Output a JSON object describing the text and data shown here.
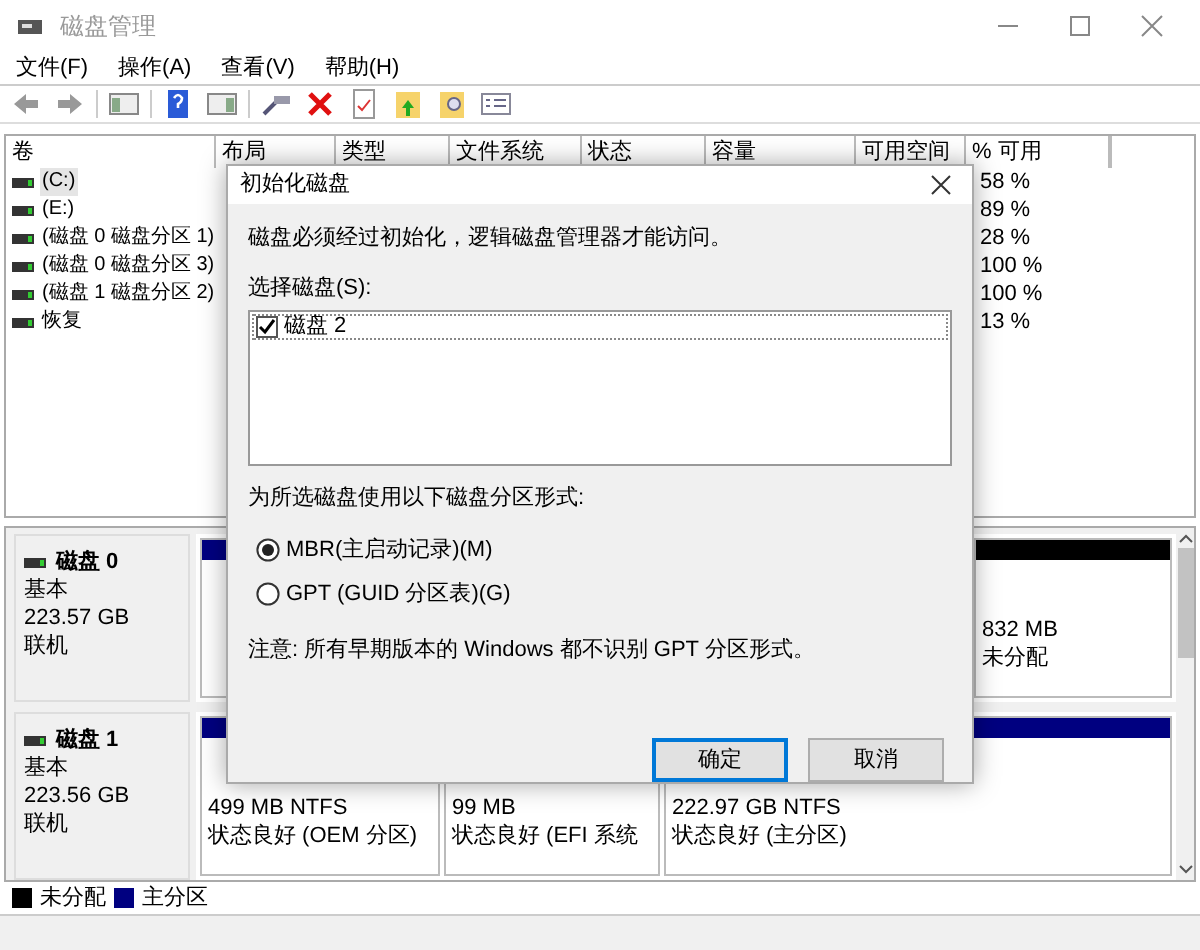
{
  "window": {
    "title": "磁盘管理"
  },
  "menu": [
    "文件(F)",
    "操作(A)",
    "查看(V)",
    "帮助(H)"
  ],
  "volume_table": {
    "columns": [
      "卷",
      "布局",
      "类型",
      "文件系统",
      "状态",
      "容量",
      "可用空间",
      "% 可用"
    ],
    "rows": [
      {
        "volume": "(C:)",
        "percent_free": "58 %",
        "selected": true
      },
      {
        "volume": "(E:)",
        "percent_free": "89 %",
        "selected": false
      },
      {
        "volume": "(磁盘 0 磁盘分区 1)",
        "percent_free": "28 %",
        "selected": false
      },
      {
        "volume": "(磁盘 0 磁盘分区 3)",
        "percent_free": "100 %",
        "selected": false
      },
      {
        "volume": "(磁盘 1 磁盘分区 2)",
        "percent_free": "100 %",
        "selected": false
      },
      {
        "volume": "恢复",
        "percent_free": "13 %",
        "selected": false
      }
    ]
  },
  "disks": [
    {
      "name": "磁盘 0",
      "type": "基本",
      "size": "223.57 GB",
      "status": "联机",
      "partitions": [
        {
          "kind": "primary"
        },
        {
          "kind": "unallocated",
          "lines": [
            "832 MB",
            "未分配"
          ]
        }
      ]
    },
    {
      "name": "磁盘 1",
      "type": "基本",
      "size": "223.56 GB",
      "status": "联机",
      "partitions": [
        {
          "kind": "primary",
          "lines": [
            "499 MB NTFS",
            "状态良好 (OEM 分区)"
          ]
        },
        {
          "lines": [
            "99 MB",
            "状态良好 (EFI 系统"
          ]
        },
        {
          "kind": "primary",
          "lines": [
            "222.97 GB NTFS",
            "状态良好 (主分区)"
          ]
        }
      ]
    }
  ],
  "legend": [
    {
      "label": "未分配",
      "color": "#000000"
    },
    {
      "label": "主分区",
      "color": "#000080"
    }
  ],
  "dialog": {
    "title": "初始化磁盘",
    "message": "磁盘必须经过初始化，逻辑磁盘管理器才能访问。",
    "select_label": "选择磁盘(S):",
    "disks": [
      {
        "label": "磁盘 2",
        "checked": true
      }
    ],
    "style_label": "为所选磁盘使用以下磁盘分区形式:",
    "styles": [
      {
        "label": "MBR(主启动记录)(M)",
        "selected": true
      },
      {
        "label": "GPT (GUID 分区表)(G)",
        "selected": false
      }
    ],
    "note": "注意: 所有早期版本的 Windows 都不识别 GPT 分区形式。",
    "buttons": [
      {
        "label": "确定",
        "default": true
      },
      {
        "label": "取消",
        "default": false
      }
    ]
  }
}
